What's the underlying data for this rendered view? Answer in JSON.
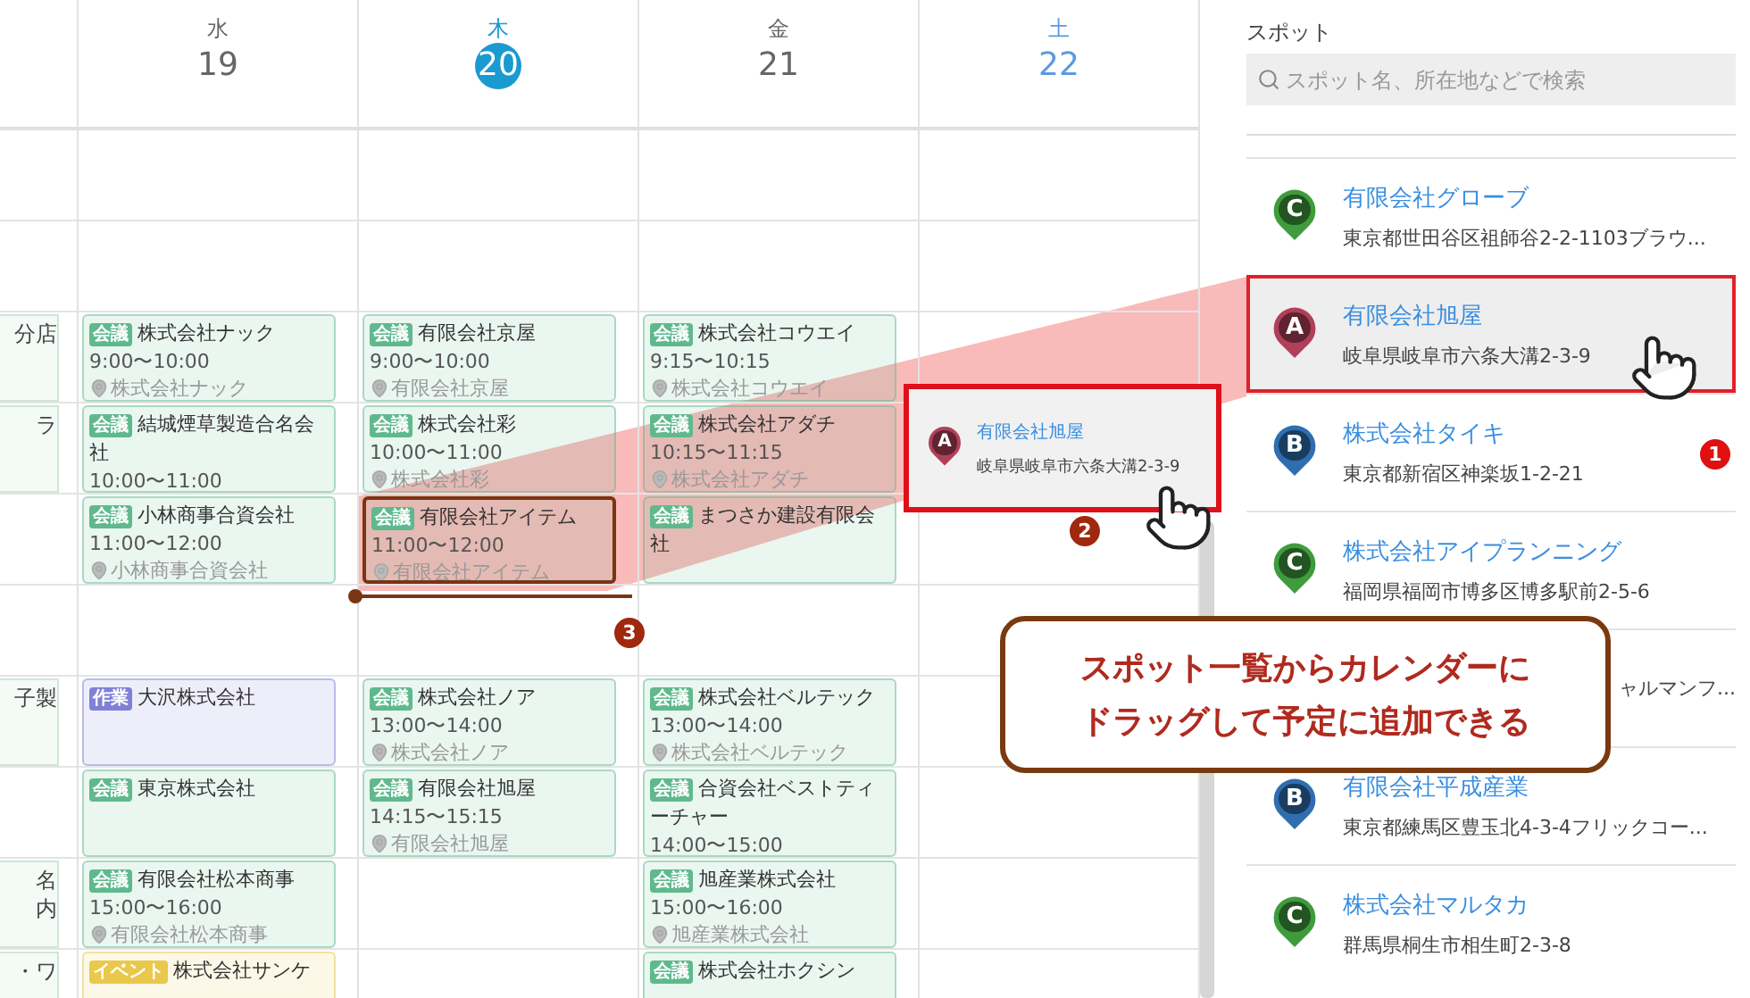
{
  "calendar": {
    "left_column": [
      {
        "kind": "fragment",
        "lines": [
          "分店"
        ]
      },
      {
        "kind": "fragment",
        "lines": [
          "ラ"
        ]
      },
      {
        "kind": "free"
      },
      {
        "kind": "free"
      },
      {
        "kind": "fragment",
        "lines": [
          "子製"
        ]
      },
      {
        "kind": "free"
      },
      {
        "kind": "fragment",
        "lines": [
          "名",
          "内"
        ]
      },
      {
        "kind": "fragment",
        "lines": [
          "・ワ"
        ]
      }
    ],
    "days": [
      {
        "weekday": "水",
        "date": "19",
        "today": false,
        "weekend": false,
        "slots": [
          {
            "kind": "event",
            "tag": "会議",
            "color": "#5fb98d",
            "title": "株式会社ナック",
            "time": "9:00〜10:00",
            "location": "株式会社ナック",
            "outlined": false
          },
          {
            "kind": "event",
            "tag": "会議",
            "color": "#5fb98d",
            "title": "結城煙草製造合名会社",
            "time": "10:00〜11:00",
            "outlined": false
          },
          {
            "kind": "event",
            "tag": "会議",
            "color": "#5fb98d",
            "title": "小林商事合資会社",
            "time": "11:00〜12:00",
            "location": "小林商事合資会社",
            "outlined": false
          },
          {
            "kind": "free"
          },
          {
            "kind": "event",
            "tag": "作業",
            "color": "#7f80d6",
            "title": "大沢株式会社",
            "outlined": false
          },
          {
            "kind": "event",
            "tag": "会議",
            "color": "#5fb98d",
            "title": "東京株式会社",
            "outlined": false
          },
          {
            "kind": "event",
            "tag": "会議",
            "color": "#5fb98d",
            "title": "有限会社松本商事",
            "time": "15:00〜16:00",
            "location": "有限会社松本商事",
            "outlined": false
          },
          {
            "kind": "event",
            "tag": "イベント",
            "color": "#e9c84c",
            "title": "株式会社サンケ",
            "outlined": false
          }
        ]
      },
      {
        "weekday": "木",
        "date": "20",
        "today": true,
        "weekend": false,
        "slots": [
          {
            "kind": "event",
            "tag": "会議",
            "color": "#5fb98d",
            "title": "有限会社京屋",
            "time": "9:00〜10:00",
            "location": "有限会社京屋",
            "outlined": false
          },
          {
            "kind": "event",
            "tag": "会議",
            "color": "#5fb98d",
            "title": "株式会社彩",
            "time": "10:00〜11:00",
            "location": "株式会社彩",
            "outlined": false
          },
          {
            "kind": "event",
            "tag": "会議",
            "color": "#5fb98d",
            "title": "有限会社アイテム",
            "time": "11:00〜12:00",
            "location": "有限会社アイテム",
            "outlined": true
          },
          {
            "kind": "free"
          },
          {
            "kind": "event",
            "tag": "会議",
            "color": "#5fb98d",
            "title": "株式会社ノア",
            "time": "13:00〜14:00",
            "location": "株式会社ノア",
            "outlined": false
          },
          {
            "kind": "event",
            "tag": "会議",
            "color": "#5fb98d",
            "title": "有限会社旭屋",
            "time": "14:15〜15:15",
            "location": "有限会社旭屋",
            "outlined": false
          }
        ]
      },
      {
        "weekday": "金",
        "date": "21",
        "today": false,
        "weekend": false,
        "slots": [
          {
            "kind": "event",
            "tag": "会議",
            "color": "#5fb98d",
            "title": "株式会社コウエイ",
            "time": "9:15〜10:15",
            "location": "株式会社コウエイ",
            "outlined": false
          },
          {
            "kind": "event",
            "tag": "会議",
            "color": "#5fb98d",
            "title": "株式会社アダチ",
            "time": "10:15〜11:15",
            "location": "株式会社アダチ",
            "outlined": false
          },
          {
            "kind": "event",
            "tag": "会議",
            "color": "#5fb98d",
            "title": "まつさか建設有限会社",
            "outlined": false
          },
          {
            "kind": "free"
          },
          {
            "kind": "event",
            "tag": "会議",
            "color": "#5fb98d",
            "title": "株式会社ベルテック",
            "time": "13:00〜14:00",
            "location": "株式会社ベルテック",
            "outlined": false
          },
          {
            "kind": "event",
            "tag": "会議",
            "color": "#5fb98d",
            "title": "合資会社ベストティーチャー",
            "time": "14:00〜15:00",
            "outlined": false
          },
          {
            "kind": "event",
            "tag": "会議",
            "color": "#5fb98d",
            "title": "旭産業株式会社",
            "time": "15:00〜16:00",
            "location": "旭産業株式会社",
            "outlined": false
          },
          {
            "kind": "event",
            "tag": "会議",
            "color": "#5fb98d",
            "title": "株式会社ホクシン",
            "outlined": false
          }
        ]
      },
      {
        "weekday": "土",
        "date": "22",
        "today": false,
        "weekend": true
      }
    ]
  },
  "sidebar": {
    "title": "スポット",
    "search": {
      "placeholder": "スポット名、所在地などで検索"
    },
    "spots": [
      {
        "kind": "spot",
        "pin": "C",
        "color": "#3f9c3c",
        "name": "有限会社グローブ",
        "address": "東京都世田谷区祖師谷2-2-1103ブラウ...",
        "selected": false
      },
      {
        "kind": "spot",
        "pin": "A",
        "color": "#b0405a",
        "name": "有限会社旭屋",
        "address": "岐阜県岐阜市六条大溝2-3-9",
        "selected": true
      },
      {
        "kind": "spot",
        "pin": "B",
        "color": "#2f6fb0",
        "name": "株式会社タイキ",
        "address": "東京都新宿区神楽坂1-2-21",
        "selected": false
      },
      {
        "kind": "spot",
        "pin": "C",
        "color": "#3f9c3c",
        "name": "株式会社アイプランニング",
        "address": "福岡県福岡市博多区博多駅前2-5-6",
        "selected": false
      },
      {
        "kind": "covered",
        "address": "ャルマンフ..."
      },
      {
        "kind": "spot",
        "pin": "B",
        "color": "#2f6fb0",
        "name": "有限会社平成産業",
        "address": "東京都練馬区豊玉北4-3-4フリックコー...",
        "selected": false
      },
      {
        "kind": "spot",
        "pin": "C",
        "color": "#3f9c3c",
        "name": "株式会社マルタカ",
        "address": "群馬県桐生市相生町2-3-8",
        "selected": false
      }
    ]
  },
  "drag_card": {
    "pin": "A",
    "color": "#b0405a",
    "name": "有限会社旭屋",
    "address": "岐阜県岐阜市六条大溝2-3-9"
  },
  "badges": [
    {
      "text": "1",
      "color": "#e01010"
    },
    {
      "text": "2",
      "color": "#a0280e"
    },
    {
      "text": "3",
      "color": "#a0280e"
    }
  ],
  "callout": {
    "lines": [
      "スポット一覧からカレンダーに",
      "ドラッグして予定に追加できる"
    ]
  }
}
